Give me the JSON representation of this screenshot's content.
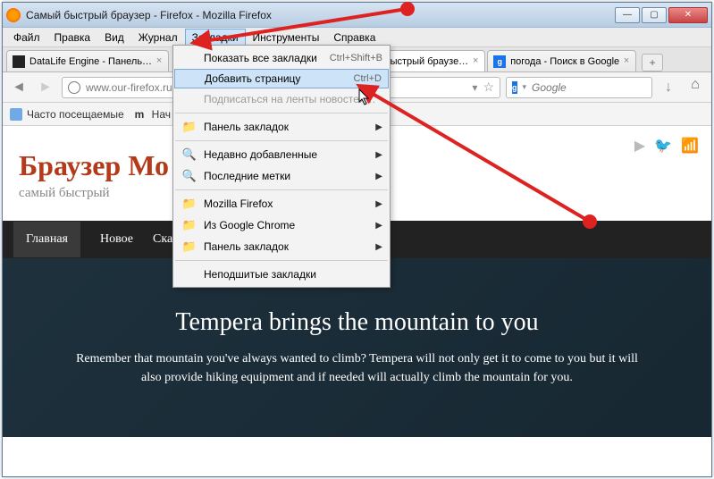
{
  "window": {
    "title": "Самый быстрый браузер - Firefox - Mozilla Firefox"
  },
  "menubar": {
    "items": [
      {
        "label": "Файл",
        "accel": "Ф"
      },
      {
        "label": "Правка",
        "accel": "П"
      },
      {
        "label": "Вид"
      },
      {
        "label": "Журнал",
        "accel": "Ж"
      },
      {
        "label": "Закладки",
        "accel": "З",
        "open": true
      },
      {
        "label": "Инструменты",
        "accel": "И"
      },
      {
        "label": "Справка",
        "accel": "С"
      }
    ]
  },
  "bookmarks_menu": {
    "items": [
      {
        "label": "Показать все закладки",
        "shortcut": "Ctrl+Shift+B",
        "type": "item"
      },
      {
        "label": "Добавить страницу",
        "shortcut": "Ctrl+D",
        "type": "item",
        "highlight": true
      },
      {
        "label": "Подписаться на ленты новостей…",
        "type": "item",
        "disabled": true
      },
      {
        "type": "sep"
      },
      {
        "label": "Панель закладок",
        "icon": "folder",
        "type": "submenu"
      },
      {
        "type": "sep"
      },
      {
        "label": "Недавно добавленные",
        "icon": "search",
        "type": "submenu"
      },
      {
        "label": "Последние метки",
        "icon": "search",
        "type": "submenu"
      },
      {
        "type": "sep"
      },
      {
        "label": "Mozilla Firefox",
        "icon": "folder",
        "type": "submenu"
      },
      {
        "label": "Из Google Chrome",
        "icon": "folder",
        "type": "submenu"
      },
      {
        "label": "Панель закладок",
        "icon": "folder",
        "type": "submenu"
      },
      {
        "type": "sep"
      },
      {
        "label": "Неподшитые закладки",
        "type": "item"
      }
    ]
  },
  "tabs": [
    {
      "label": "DataLife Engine - Панель…",
      "icon": "dle"
    },
    {
      "label": "й быстрый браузе…",
      "icon": "ff",
      "active": true
    },
    {
      "label": "погода - Поиск в Google",
      "icon": "g"
    }
  ],
  "address": {
    "url": "www.our-firefox.ru"
  },
  "search": {
    "placeholder": "Google",
    "engine_icon": "g"
  },
  "bookmark_bar": [
    {
      "label": "Часто посещаемые",
      "icon": "square"
    },
    {
      "label": "Нач",
      "icon": "m"
    }
  ],
  "page": {
    "title_prefix": "Браузер Мо",
    "subtitle": "самый быстрый",
    "nav": [
      {
        "label": "Главная",
        "active": true
      },
      {
        "label": "Новое"
      },
      {
        "label": "Скачать"
      }
    ],
    "hero_title": "Tempera brings the mountain to you",
    "hero_text": "Remember that mountain you've always wanted to climb? Tempera will not only get it to come to you but it will also provide hiking equipment and if needed will actually climb the mountain for you."
  }
}
